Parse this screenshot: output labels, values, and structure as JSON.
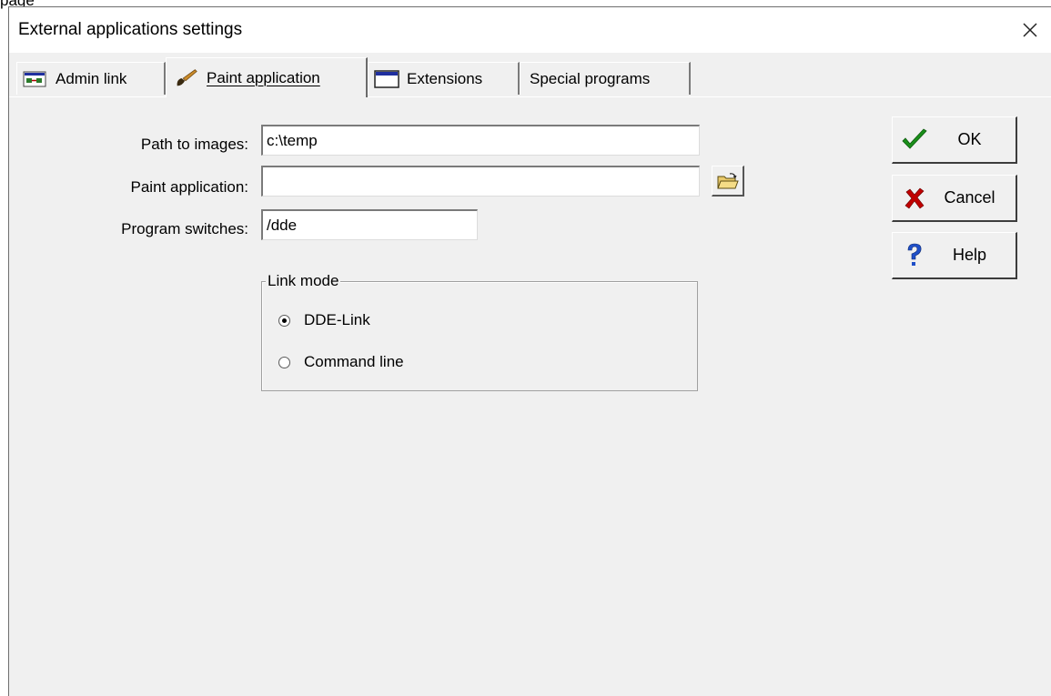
{
  "page_text": "page",
  "window": {
    "title": "External applications settings",
    "close_glyph": "✕"
  },
  "tabs": [
    {
      "label": "Admin link",
      "icon": "admin-link-icon",
      "active": false
    },
    {
      "label": "Paint application",
      "icon": "paint-brush-icon",
      "active": true
    },
    {
      "label": "Extensions",
      "icon": "window-icon",
      "active": false
    },
    {
      "label": "Special programs",
      "icon": "",
      "active": false
    }
  ],
  "form": {
    "path_label": "Path to images:",
    "path_value": "c:\\temp",
    "paint_label": "Paint application:",
    "paint_value": "",
    "switches_label": "Program switches:",
    "switches_value": "/dde"
  },
  "link_mode": {
    "legend": "Link mode",
    "options": [
      {
        "label": "DDE-Link",
        "checked": true
      },
      {
        "label": "Command line",
        "checked": false
      }
    ]
  },
  "buttons": {
    "ok": "OK",
    "cancel": "Cancel",
    "help": "Help"
  },
  "colors": {
    "ok_check": "#1a8f1a",
    "cancel_x": "#c00000",
    "help_q": "#1f4fc8"
  }
}
